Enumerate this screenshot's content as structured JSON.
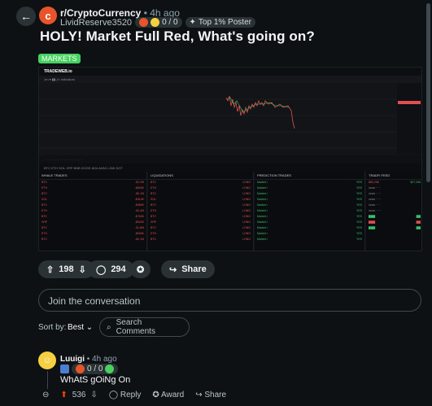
{
  "header": {
    "back_icon": "arrow-left-icon",
    "subreddit": "r/CryptoCurrency",
    "time": "• 4h ago",
    "author": "LividReserve3520",
    "karma": "0 / 0",
    "badge": "Top 1% Poster"
  },
  "post": {
    "title": "HOLY! Market Full Red, What's going on?",
    "flair": "MARKETS"
  },
  "screenshot": {
    "logo": "TRADEWEB.io",
    "price_tag": "$82,298",
    "price_tag2": "$27,346",
    "panels": [
      "WHALE TRADES",
      "LIQUIDATIONS",
      "PREDICTION TRADES",
      "TRADFI FEED"
    ]
  },
  "actions": {
    "votes": "198",
    "comments": "294",
    "share": "Share"
  },
  "join": {
    "placeholder": "Join the conversation"
  },
  "sort": {
    "label": "Sort by:",
    "value": "Best",
    "search": "Search Comments"
  },
  "comment": {
    "author": "Luuigi",
    "time": "• 4h ago",
    "karma": "0 / 0",
    "body": "WhAtS gOiNg On",
    "votes": "536",
    "reply": "Reply",
    "award": "Award",
    "share": "Share"
  },
  "colors": {
    "accent": "#46d160",
    "brand": "#e8542a",
    "down": "#e05050"
  }
}
